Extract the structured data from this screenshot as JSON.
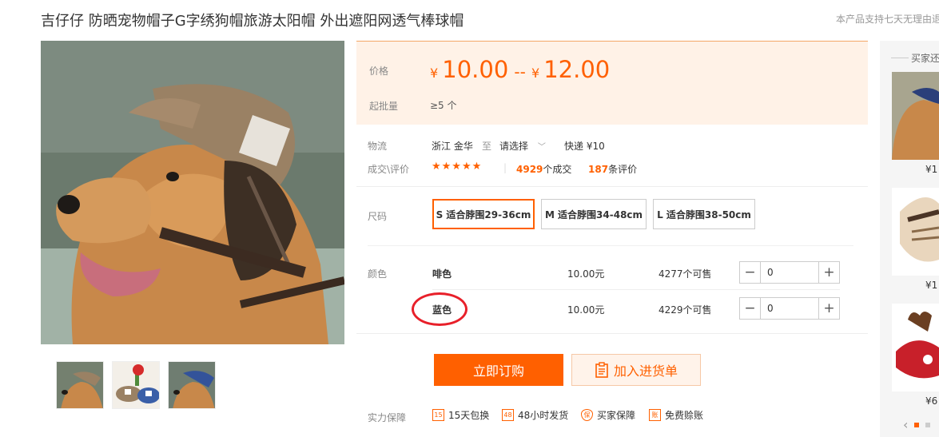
{
  "product": {
    "title": "吉仔仔 防晒宠物帽子G字绣狗帽旅游太阳帽 外出遮阳网透气棒球帽",
    "notice": "本产品支持七天无理由退"
  },
  "price": {
    "label": "价格",
    "currency": "¥",
    "min": "10.00",
    "separator": "--",
    "max": "12.00",
    "moq_label": "起批量",
    "moq_value": "≥5 个"
  },
  "logistics": {
    "label": "物流",
    "origin": "浙江 金华",
    "to": "至",
    "destination": "请选择",
    "express": "快递 ¥10"
  },
  "deals": {
    "label": "成交\\评价",
    "stars": "★★★★★",
    "orders_count": "4929",
    "orders_suffix": "个成交",
    "reviews_count": "187",
    "reviews_suffix": "条评价"
  },
  "sizes": {
    "label": "尺码",
    "options": [
      "S 适合脖围29-36cm",
      "M 适合脖围34-48cm",
      "L 适合脖围38-50cm"
    ],
    "selected_index": 0
  },
  "colors": {
    "label": "颜色",
    "rows": [
      {
        "name": "啡色",
        "price": "10.00元",
        "stock": "4277个可售",
        "qty": "0"
      },
      {
        "name": "蓝色",
        "price": "10.00元",
        "stock": "4229个可售",
        "qty": "0"
      }
    ]
  },
  "actions": {
    "order": "立即订购",
    "cart": "加入进货单"
  },
  "guarantee": {
    "label": "实力保障",
    "items": [
      {
        "icon": "15-icon",
        "glyph": "15",
        "text": "15天包换"
      },
      {
        "icon": "48-icon",
        "glyph": "48",
        "text": "48小时发货"
      },
      {
        "icon": "shield-icon",
        "glyph": "保",
        "text": "买家保障"
      },
      {
        "icon": "free-icon",
        "glyph": "账",
        "text": "免费赊账"
      }
    ]
  },
  "side": {
    "title": "买家还",
    "prices": [
      "¥1",
      "¥1",
      "¥6"
    ]
  },
  "colors_theme": {
    "accent": "#ff6000",
    "price_bg": "#fff2e7",
    "mark": "#e8202a"
  }
}
